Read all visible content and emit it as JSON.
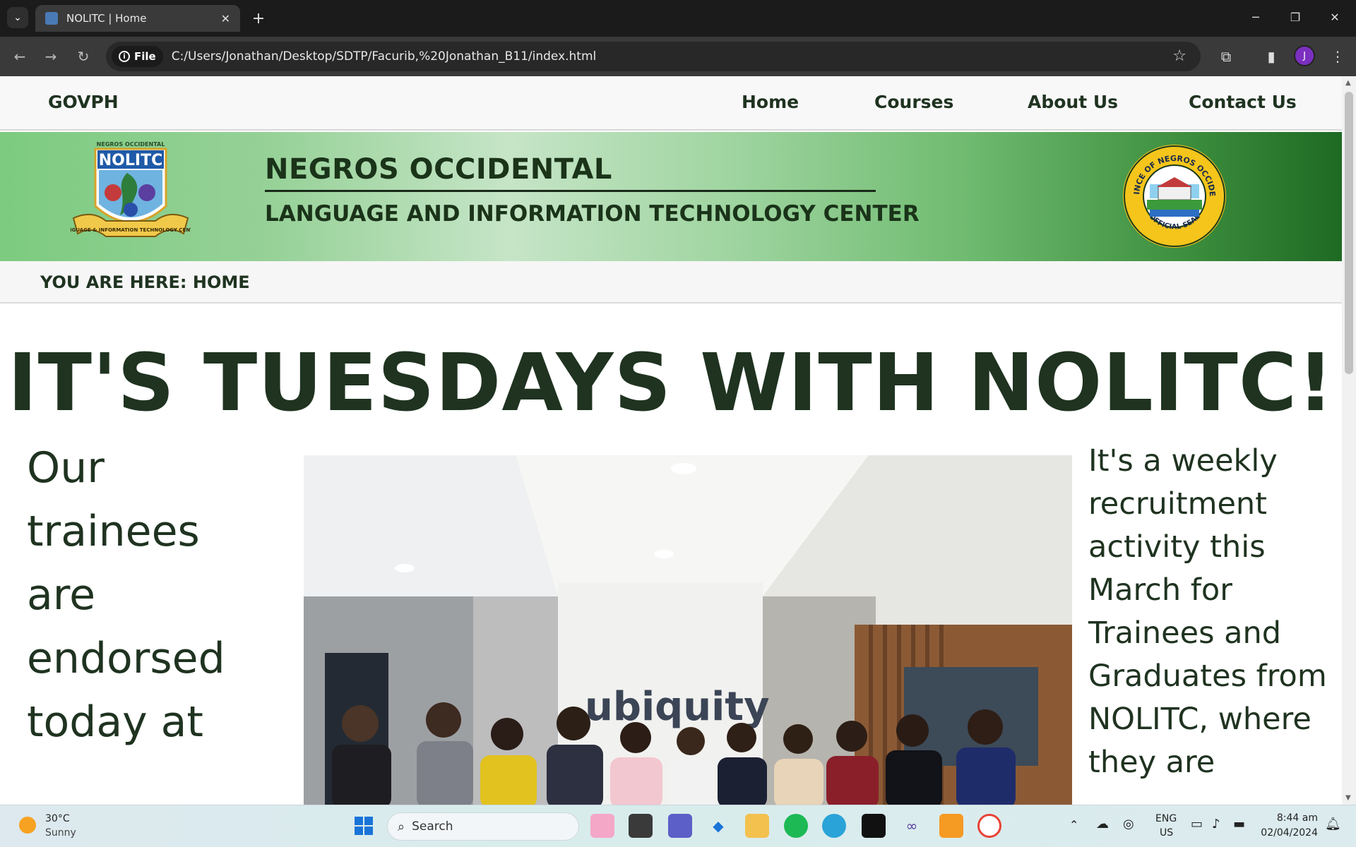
{
  "browser": {
    "tab_title": "NOLITC | Home",
    "tab_close": "✕",
    "new_tab": "+",
    "file_chip": "File",
    "url": "C:/Users/Jonathan/Desktop/SDTP/Facurib,%20Jonathan_B11/index.html",
    "profile_initial": "J"
  },
  "nav": {
    "brand": "GOVPH",
    "links": [
      "Home",
      "Courses",
      "About Us",
      "Contact Us"
    ]
  },
  "banner": {
    "title": "NEGROS OCCIDENTAL",
    "subtitle": "LANGUAGE AND INFORMATION TECHNOLOGY CENTER",
    "logo_text": "NOLITC",
    "logo_top": "NEGROS OCCIDENTAL",
    "logo_ribbon": "LANGUAGE & INFORMATION TECHNOLOGY CENTER",
    "seal_text_top": "PROVINCE OF NEGROS OCCIDENTAL",
    "seal_text_bottom": "OFFICIAL SEAL"
  },
  "breadcrumb": "YOU ARE HERE: HOME",
  "main": {
    "headline": "IT'S TUESDAYS WITH NOLITC!",
    "left_text": "Our trainees are endorsed today at",
    "right_text": "It's a weekly recruitment activity this March for Trainees and Graduates from NOLITC, where they are",
    "photo_sign": "ubiquity"
  },
  "taskbar": {
    "temp": "30°C",
    "condition": "Sunny",
    "search": "Search",
    "lang_top": "ENG",
    "lang_bottom": "US",
    "time": "8:44 am",
    "date": "02/04/2024"
  },
  "colors": {
    "text_dark_green": "#1f3320",
    "banner_left": "#7ccb80",
    "banner_right": "#1e6a24"
  }
}
